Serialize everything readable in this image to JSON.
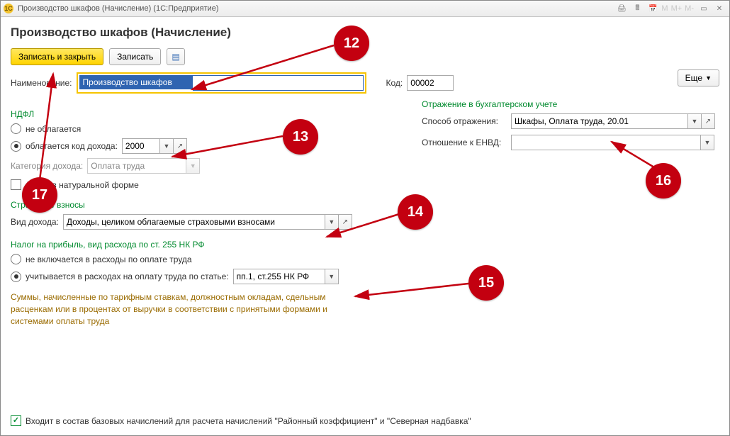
{
  "window": {
    "app_icon_text": "1С",
    "title": "Производство шкафов (Начисление)  (1С:Предприятие)",
    "zoom_levels": [
      "M",
      "M+",
      "M-"
    ]
  },
  "page_title": "Производство шкафов (Начисление)",
  "toolbar": {
    "save_close": "Записать и закрыть",
    "save": "Записать",
    "more": "Еще"
  },
  "name_row": {
    "label": "Наименование:",
    "value": "Производство шкафов",
    "code_label": "Код:",
    "code_value": "00002"
  },
  "ndfl": {
    "head": "НДФЛ",
    "opt_no_tax": "не облагается",
    "opt_tax": "облагается  код дохода:",
    "code_value": "2000",
    "category_label": "Категория дохода:",
    "category_value": "Оплата труда",
    "natural_label": "Доход в натуральной форме"
  },
  "accounting": {
    "head": "Отражение в бухгалтерском учете",
    "method_label": "Способ отражения:",
    "method_value": "Шкафы, Оплата труда, 20.01",
    "envd_label": "Отношение к ЕНВД:",
    "envd_value": ""
  },
  "insurance": {
    "head": "Страховые взносы",
    "kind_label": "Вид дохода:",
    "kind_value": "Доходы, целиком облагаемые страховыми взносами"
  },
  "profit": {
    "head": "Налог на прибыль, вид расхода по ст. 255 НК РФ",
    "opt_exclude": "не включается в расходы по оплате труда",
    "opt_include": "учитывается в расходах на оплату труда по статье:",
    "article_value": "пп.1, ст.255 НК РФ"
  },
  "footnote": "Суммы, начисленные по тарифным ставкам, должностным окладам, сдельным расценкам или в процентах от выручки в соответствии с принятыми формами и системами оплаты труда",
  "bottom_check": "Входит в состав базовых начислений для расчета начислений \"Районный коэффициент\" и \"Северная надбавка\"",
  "annotations": {
    "b12": "12",
    "b13": "13",
    "b14": "14",
    "b15": "15",
    "b16": "16",
    "b17": "17"
  }
}
